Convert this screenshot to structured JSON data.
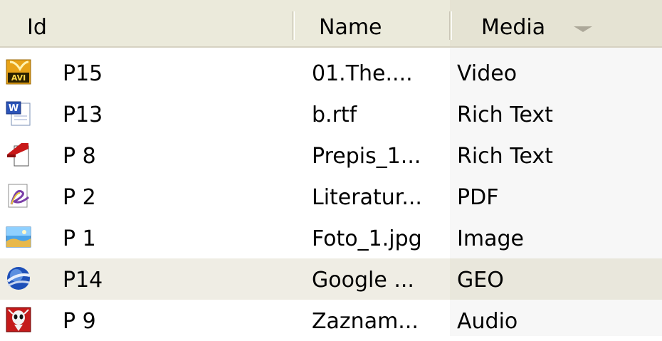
{
  "columns": {
    "id": "Id",
    "name": "Name",
    "media": "Media"
  },
  "rows": [
    {
      "icon": "avi-file-icon",
      "id": "P15",
      "name": "01.The....",
      "media": "Video"
    },
    {
      "icon": "word-document-icon",
      "id": "P13",
      "name": "b.rtf",
      "media": "Rich Text"
    },
    {
      "icon": "rich-text-document-icon",
      "id": "P 8",
      "name": "Prepis_1...",
      "media": "Rich Text"
    },
    {
      "icon": "pdf-file-icon",
      "id": "P 2",
      "name": "Literatur...",
      "media": "PDF"
    },
    {
      "icon": "image-file-icon",
      "id": "P 1",
      "name": "Foto_1.jpg",
      "media": "Image"
    },
    {
      "icon": "google-earth-icon",
      "id": "P14",
      "name": "Google ...",
      "media": "GEO"
    },
    {
      "icon": "audio-file-icon",
      "id": "P 9",
      "name": "Zaznam...",
      "media": "Audio"
    }
  ],
  "selected_row": "P14"
}
